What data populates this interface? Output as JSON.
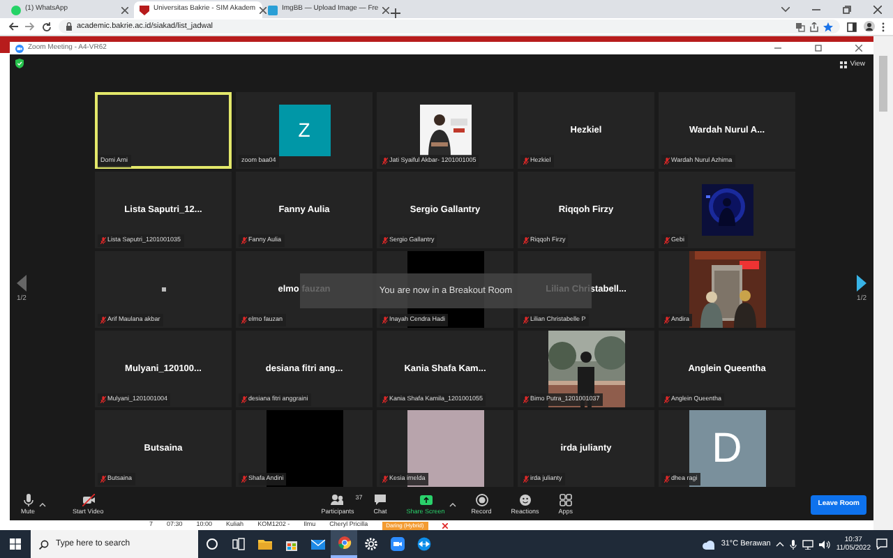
{
  "browser": {
    "tabs": [
      {
        "title": "(1) WhatsApp",
        "selected": false
      },
      {
        "title": "Universitas Bakrie - SIM Akadem",
        "selected": true
      },
      {
        "title": "ImgBB — Upload Image — Fre",
        "selected": false
      }
    ],
    "url": "academic.bakrie.ac.id/siakad/list_jadwal"
  },
  "zoom": {
    "title": "Zoom Meeting - A4-VR62",
    "view_button": "View",
    "prev_enabled": false,
    "next_enabled": true,
    "page_left": "1/2",
    "page_right": "1/2",
    "toast": "You are now in a Breakout Room",
    "tiles": [
      {
        "label": "Domi Arni",
        "muted": false,
        "kind": "blank",
        "selected": true
      },
      {
        "label": "zoom baa04",
        "muted": false,
        "kind": "avatar",
        "letter": "Z",
        "color": "#0097a7",
        "selected": false
      },
      {
        "label": "Jati Syaiful Akbar- 1201001005",
        "muted": true,
        "kind": "profile_picture",
        "selected": false
      },
      {
        "label": "Hezkiel",
        "muted": true,
        "kind": "name",
        "name": "Hezkiel",
        "selected": false
      },
      {
        "label": "Wardah Nurul Azhima",
        "muted": true,
        "kind": "name",
        "name": "Wardah Nurul A...",
        "selected": false
      },
      {
        "label": "Lista Saputri_1201001035",
        "muted": true,
        "kind": "name",
        "name": "Lista Saputri_12...",
        "selected": false
      },
      {
        "label": "Fanny Aulia",
        "muted": true,
        "kind": "name",
        "name": "Fanny Aulia",
        "selected": false
      },
      {
        "label": "Sergio Gallantry",
        "muted": true,
        "kind": "name",
        "name": "Sergio Gallantry",
        "selected": false
      },
      {
        "label": "Riqqoh Firzy",
        "muted": true,
        "kind": "name",
        "name": "Riqqoh Firzy",
        "selected": false
      },
      {
        "label": "Gebi",
        "muted": true,
        "kind": "profile_picture",
        "selected": false
      },
      {
        "label": "Arif Maulana akbar",
        "muted": true,
        "kind": "dot",
        "selected": false
      },
      {
        "label": "elmo fauzan",
        "muted": true,
        "kind": "name",
        "name": "elmo fauzan",
        "selected": false
      },
      {
        "label": "Inayah Cendra Hadi",
        "muted": true,
        "kind": "video",
        "color": "#000000",
        "selected": false
      },
      {
        "label": "Lilian Christabelle P",
        "muted": true,
        "kind": "name",
        "name": "Lilian Christabell...",
        "selected": false
      },
      {
        "label": "Andira",
        "muted": true,
        "kind": "picture",
        "selected": false
      },
      {
        "label": "Mulyani_1201001004",
        "muted": true,
        "kind": "name",
        "name": "Mulyani_120100...",
        "selected": false
      },
      {
        "label": "desiana fitri anggraini",
        "muted": true,
        "kind": "name",
        "name": "desiana fitri ang...",
        "selected": false
      },
      {
        "label": "Kania Shafa Kamila_1201001055",
        "muted": true,
        "kind": "name",
        "name": "Kania Shafa Kam...",
        "selected": false
      },
      {
        "label": "Bimo Putra_1201001037",
        "muted": true,
        "kind": "picture",
        "selected": false
      },
      {
        "label": "Anglein Queentha",
        "muted": true,
        "kind": "name",
        "name": "Anglein Queentha",
        "selected": false
      },
      {
        "label": "Butsaina",
        "muted": true,
        "kind": "name",
        "name": "Butsaina",
        "selected": false
      },
      {
        "label": "Shafa Andini",
        "muted": true,
        "kind": "video",
        "color": "#000000",
        "selected": false
      },
      {
        "label": "Kesia imelda",
        "muted": true,
        "kind": "video",
        "color": "#b8a4ac",
        "selected": false
      },
      {
        "label": "irda julianty",
        "muted": true,
        "kind": "name",
        "name": "irda julianty",
        "selected": false
      },
      {
        "label": "dhea ragi",
        "muted": true,
        "kind": "avatar",
        "letter": "D",
        "color": "#7a909c",
        "selected": false
      }
    ],
    "toolbar": [
      {
        "label": "Mute",
        "kind": "mic",
        "caret": true
      },
      {
        "label": "Start Video",
        "kind": "video",
        "caret": false
      },
      {
        "label": "Participants",
        "kind": "participants",
        "count": "37",
        "caret": false
      },
      {
        "label": "Chat",
        "kind": "chat",
        "caret": false
      },
      {
        "label": "Share Screen",
        "kind": "share",
        "caret": true
      },
      {
        "label": "Record",
        "kind": "record",
        "caret": false
      },
      {
        "label": "Reactions",
        "kind": "reactions",
        "caret": false
      },
      {
        "label": "Apps",
        "kind": "apps",
        "caret": false
      }
    ],
    "leave_button": "Leave Room"
  },
  "page_row": {
    "cells": [
      "7",
      "07:30",
      "10:00",
      "Kuliah",
      "KOM1202 -",
      "Ilmu",
      "Cheryl Pricilla"
    ],
    "badge": "Daring (Hybrid)"
  },
  "taskbar": {
    "search_placeholder": "Type here to search",
    "weather": "31°C Berawan",
    "time": "10:37",
    "date": "11/05/2022"
  }
}
